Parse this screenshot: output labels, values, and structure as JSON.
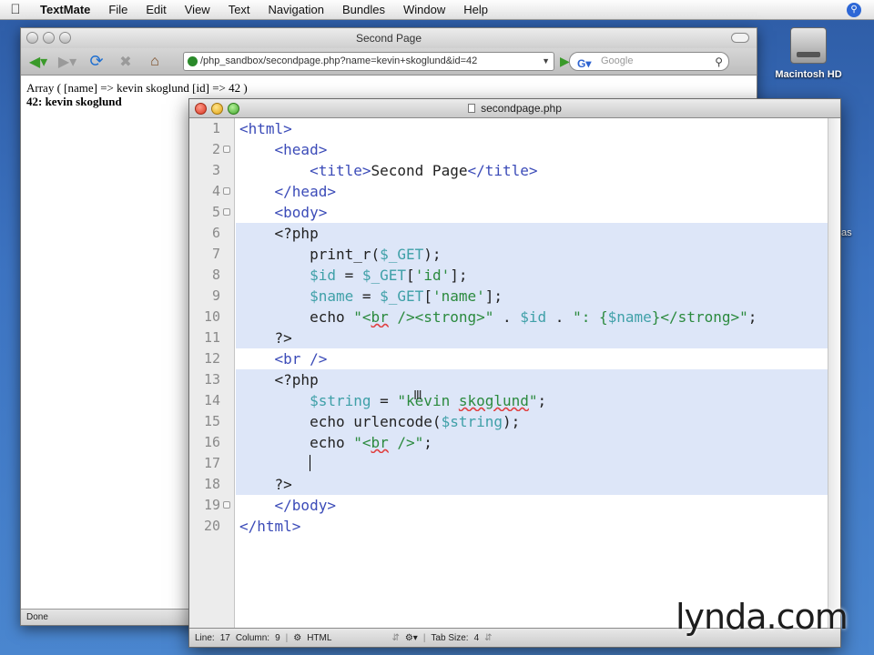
{
  "menubar": {
    "app": "TextMate",
    "items": [
      "File",
      "Edit",
      "View",
      "Text",
      "Navigation",
      "Bundles",
      "Window",
      "Help"
    ]
  },
  "desktop": {
    "hd_label": "Macintosh HD",
    "edge_text": "as"
  },
  "browser": {
    "title": "Second Page",
    "url": "/php_sandbox/secondpage.php?name=kevin+skoglund&id=42",
    "search_placeholder": "Google",
    "content_line1": "Array ( [name] => kevin skoglund [id] => 42 )",
    "content_line2": "42: kevin skoglund",
    "status": "Done"
  },
  "editor": {
    "title": "secondpage.php",
    "line_numbers": [
      "1",
      "2",
      "3",
      "4",
      "5",
      "6",
      "7",
      "8",
      "9",
      "10",
      "11",
      "12",
      "13",
      "14",
      "15",
      "16",
      "17",
      "18",
      "19",
      "20"
    ],
    "status": {
      "line_label": "Line:",
      "line_value": "17",
      "column_label": "Column:",
      "column_value": "9",
      "language": "HTML",
      "tab_label": "Tab Size:",
      "tab_value": "4"
    }
  },
  "watermark": "lynda.com"
}
